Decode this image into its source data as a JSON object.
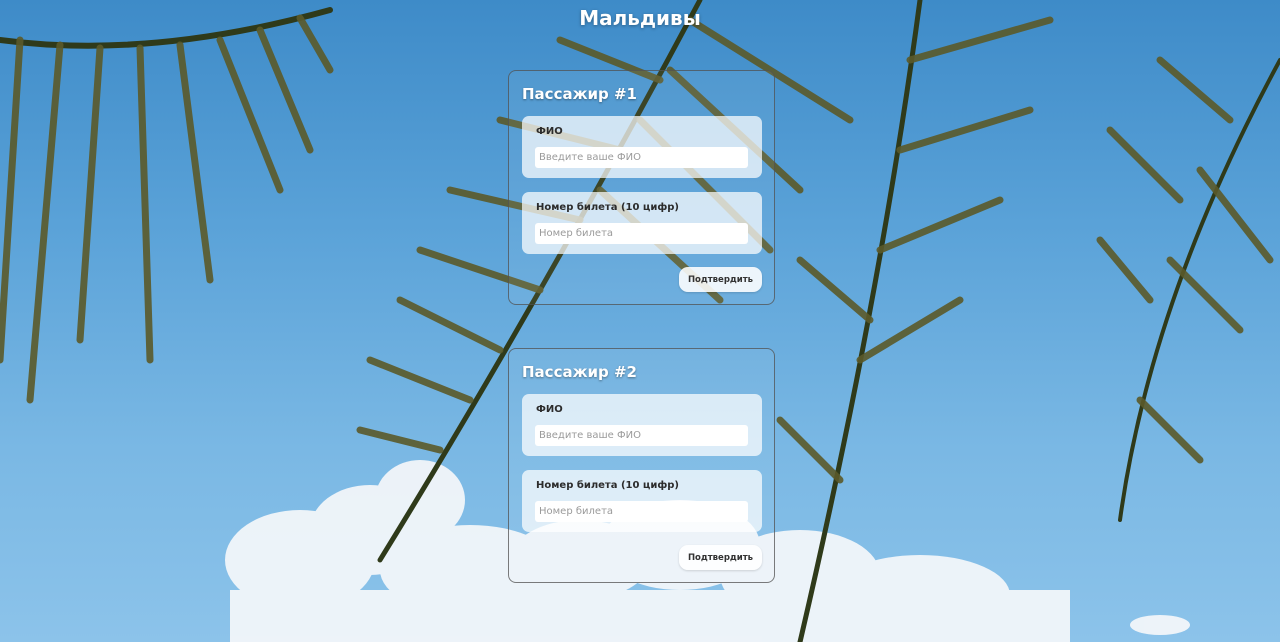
{
  "page": {
    "title": "Мальдивы"
  },
  "colors": {
    "sky": "#5aa2d8",
    "text_white": "#ffffff"
  },
  "passengers": [
    {
      "title": "Пассажир #1",
      "name_field": {
        "label": "ФИО",
        "placeholder": "Введите ваше ФИО",
        "value": ""
      },
      "ticket_field": {
        "label": "Номер билета (10 цифр)",
        "placeholder": "Номер билета",
        "value": ""
      },
      "confirm_label": "Подтвердить"
    },
    {
      "title": "Пассажир #2",
      "name_field": {
        "label": "ФИО",
        "placeholder": "Введите ваше ФИО",
        "value": ""
      },
      "ticket_field": {
        "label": "Номер билета (10 цифр)",
        "placeholder": "Номер билета",
        "value": ""
      },
      "confirm_label": "Подтвердить"
    }
  ]
}
